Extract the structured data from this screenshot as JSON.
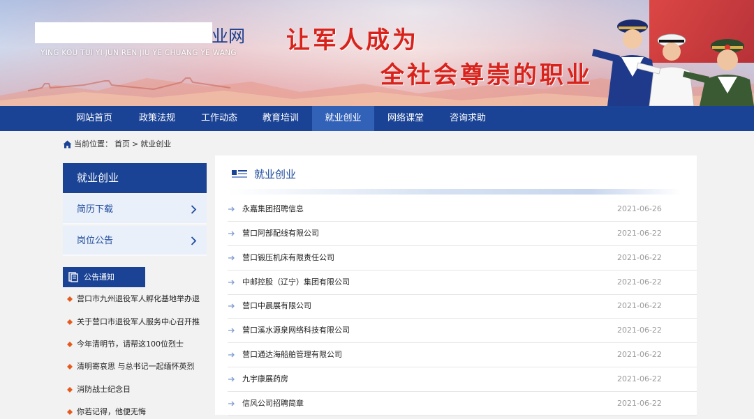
{
  "banner": {
    "logo_suffix": "业网",
    "logo_pinyin": "YING KOU TUI YI JUN REN JIU YE CHUANG YE WANG",
    "slogan_line1": "让军人成为",
    "slogan_line2": "全社会尊崇的职业"
  },
  "nav": {
    "items": [
      {
        "label": "网站首页"
      },
      {
        "label": "政策法规"
      },
      {
        "label": "工作动态"
      },
      {
        "label": "教育培训"
      },
      {
        "label": "就业创业"
      },
      {
        "label": "网络课堂"
      },
      {
        "label": "咨询求助"
      }
    ],
    "active_index": 4
  },
  "breadcrumb": {
    "prefix": "当前位置：",
    "home": "首页",
    "separator": ">",
    "current": "就业创业"
  },
  "sidebar": {
    "title": "就业创业",
    "items": [
      {
        "label": "简历下载"
      },
      {
        "label": "岗位公告"
      }
    ]
  },
  "notices": {
    "title": "公告通知",
    "items": [
      {
        "text": "营口市九州退役军人孵化基地举办退"
      },
      {
        "text": "关于营口市退役军人服务中心召开推"
      },
      {
        "text": "今年清明节，请帮这100位烈士"
      },
      {
        "text": "清明寄哀思 与总书记一起缅怀英烈"
      },
      {
        "text": "消防战士纪念日"
      },
      {
        "text": "你若记得，他便无悔"
      }
    ]
  },
  "content": {
    "title": "就业创业",
    "articles": [
      {
        "title": "永嘉集团招聘信息",
        "date": "2021-06-26"
      },
      {
        "title": "营口阿部配线有限公司",
        "date": "2021-06-22"
      },
      {
        "title": "营口锻压机床有限责任公司",
        "date": "2021-06-22"
      },
      {
        "title": "中邮控股（辽宁）集团有限公司",
        "date": "2021-06-22"
      },
      {
        "title": "营口中晨展有限公司",
        "date": "2021-06-22"
      },
      {
        "title": "营口溪水源泉网络科技有限公司",
        "date": "2021-06-22"
      },
      {
        "title": "营口通达海船舶管理有限公司",
        "date": "2021-06-22"
      },
      {
        "title": "九宇康展药房",
        "date": "2021-06-22"
      },
      {
        "title": "信风公司招聘简章",
        "date": "2021-06-22"
      }
    ]
  },
  "colors": {
    "nav_bg": "#1b4395",
    "nav_active": "#3261b8",
    "slogan": "#d8231c",
    "link_blue": "#1e4b9c"
  },
  "icons": {
    "breadcrumb": "home-icon",
    "sidebar_chevron": "chevron-right-icon",
    "notice_header": "book-icon",
    "notice_bullet": "bullet-dot-icon",
    "panel_title": "list-icon",
    "row_bullet": "arrow-right-icon"
  }
}
